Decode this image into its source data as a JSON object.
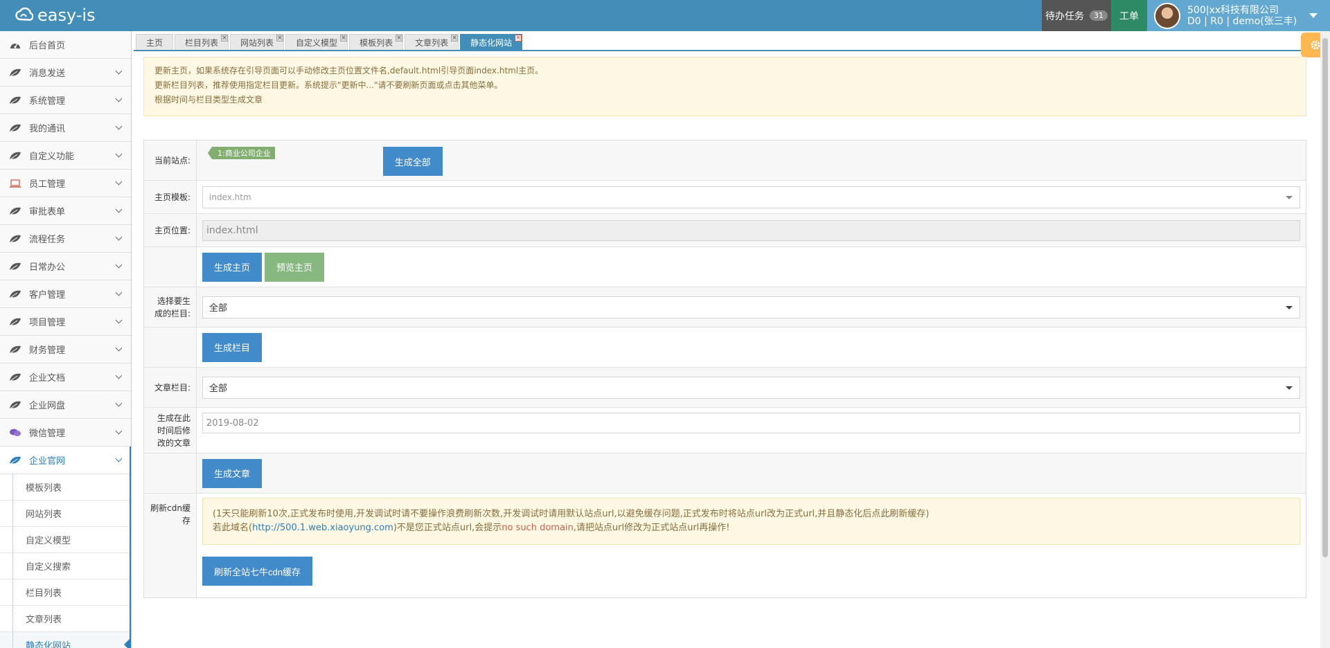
{
  "header": {
    "logo": "easy-is",
    "task_label": "待办任务",
    "task_count": "31",
    "ticket_label": "工单",
    "company": "500|xx科技有限公司",
    "user": "D0 | R0 | demo(张三丰)"
  },
  "sidebar": {
    "items": [
      {
        "label": "后台首页",
        "icon": "dashboard-icon"
      },
      {
        "label": "消息发送",
        "icon": "leaf-icon"
      },
      {
        "label": "系统管理",
        "icon": "leaf-icon"
      },
      {
        "label": "我的通讯",
        "icon": "leaf-icon"
      },
      {
        "label": "自定义功能",
        "icon": "leaf-icon"
      },
      {
        "label": "员工管理",
        "icon": "laptop-icon"
      },
      {
        "label": "审批表单",
        "icon": "leaf-icon"
      },
      {
        "label": "流程任务",
        "icon": "leaf-icon"
      },
      {
        "label": "日常办公",
        "icon": "leaf-icon"
      },
      {
        "label": "客户管理",
        "icon": "leaf-icon"
      },
      {
        "label": "项目管理",
        "icon": "leaf-icon"
      },
      {
        "label": "财务管理",
        "icon": "leaf-icon"
      },
      {
        "label": "企业文档",
        "icon": "leaf-icon"
      },
      {
        "label": "企业网盘",
        "icon": "leaf-icon"
      },
      {
        "label": "微信管理",
        "icon": "chat-icon"
      },
      {
        "label": "企业官网",
        "icon": "leaf-icon"
      }
    ],
    "sub_items": [
      "模板列表",
      "网站列表",
      "自定义模型",
      "自定义搜索",
      "栏目列表",
      "文章列表",
      "静态化网站"
    ]
  },
  "tabs": [
    "主页",
    "栏目列表",
    "网站列表",
    "自定义模型",
    "模板列表",
    "文章列表",
    "静态化网站"
  ],
  "notice": [
    "更新主页，如果系统存在引导页面可以手动修改主页位置文件名,default.html引导页面index.html主页。",
    "更新栏目列表，推荐使用指定栏目更新。系统提示\"更新中...\"请不要刷新页面或点击其他菜单。",
    "根据时间与栏目类型生成文章"
  ],
  "form": {
    "site_label": "当前站点:",
    "site_tag": "1:商业公司企业",
    "gen_all": "生成全部",
    "home_tpl_label": "主页模板:",
    "home_tpl_value": "index.htm",
    "home_pos_label": "主页位置:",
    "home_pos_value": "index.html",
    "gen_home": "生成主页",
    "preview_home": "预览主页",
    "column_label": "选择要生成的栏目:",
    "column_value": "全部",
    "gen_column": "生成栏目",
    "article_col_label": "文章栏目:",
    "article_col_value": "全部",
    "date_label": "生成在此时间后修改的文章",
    "date_value": "2019-08-02",
    "gen_article": "生成文章",
    "cdn_label": "刷新cdn缓存",
    "cdn_line1": "(1天只能刷新10次,正式发布时使用,开发调试时请不要操作浪费刷新次数,开发调试时请用默认站点url,以避免缓存问题,正式发布时将站点url改为正式url,并且静态化后点此刷新缓存)",
    "cdn_line2_a": "若此域名(",
    "cdn_url": "http://500.1.web.xiaoyung.com",
    "cdn_line2_b": ")不是您正式站点url,会提示",
    "cdn_error": "no such domain",
    "cdn_line2_c": ",请把站点url修改为正式站点url再操作!",
    "cdn_button": "刷新全站七牛cdn缓存"
  }
}
